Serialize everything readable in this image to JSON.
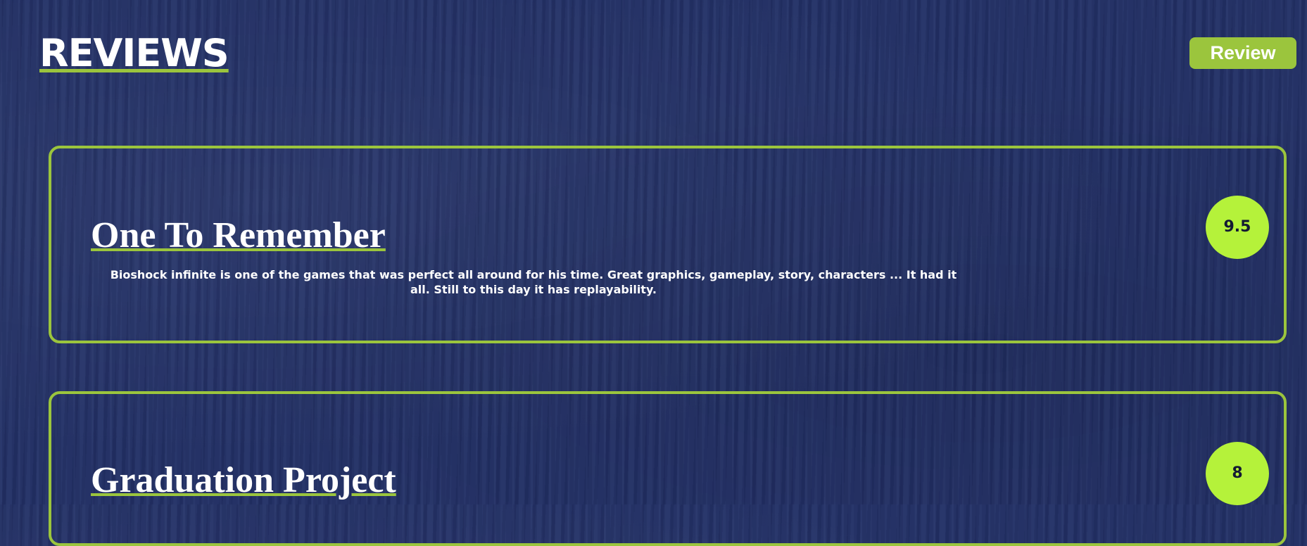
{
  "header": {
    "title": "REVIEWS",
    "review_button_label": "Review"
  },
  "reviews": [
    {
      "title": "One To Remember",
      "body": "Bioshock infinite is one of the games that was perfect all around for his time. Great graphics, gameplay, story, characters ... It had it all. Still to this day it has replayability.",
      "score": "9.5"
    },
    {
      "title": "Graduation Project",
      "score": "8"
    }
  ],
  "colors": {
    "background": "#223066",
    "accent": "#9bc53d",
    "score_badge": "#b5f23a",
    "text": "#ffffff"
  }
}
